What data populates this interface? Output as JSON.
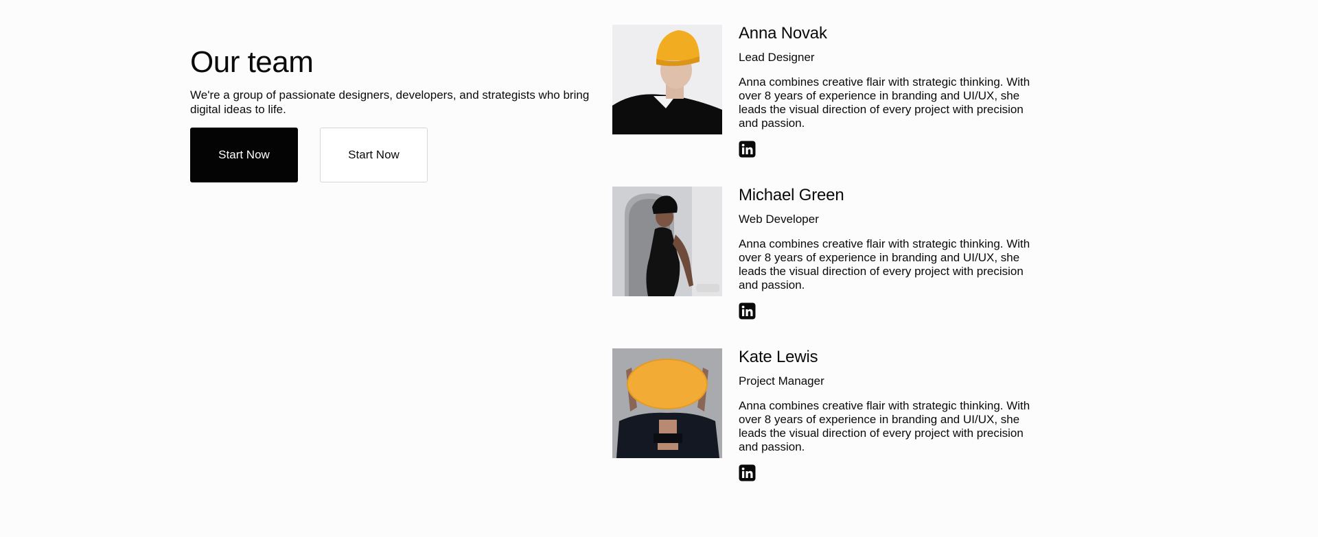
{
  "intro": {
    "title": "Our team",
    "description": "We're a group of passionate designers, developers, and strategists who bring digital ideas to life.",
    "primary_button": "Start Now",
    "secondary_button": "Start Now"
  },
  "members": [
    {
      "name": "Anna Novak",
      "role": "Lead Designer",
      "bio": "Anna combines creative flair with strategic thinking. With over 8 years of experience in branding and UI/UX, she leads the visual direction of every project with precision and passion.",
      "social_icon": "linkedin-icon"
    },
    {
      "name": "Michael Green",
      "role": "Web Developer",
      "bio": "Anna combines creative flair with strategic thinking. With over 8 years of experience in branding and UI/UX, she leads the visual direction of every project with precision and passion.",
      "social_icon": "linkedin-icon"
    },
    {
      "name": "Kate Lewis",
      "role": "Project Manager",
      "bio": "Anna combines creative flair with strategic thinking. With over 8 years of experience in branding and UI/UX, she leads the visual direction of every project with precision and passion.",
      "social_icon": "linkedin-icon"
    }
  ],
  "colors": {
    "background": "#fdfcfd",
    "text": "#0a0a0a",
    "primary_button_bg": "#050405",
    "secondary_button_border": "#d6d6d6",
    "accent_yellow": "#f0ab2c"
  }
}
